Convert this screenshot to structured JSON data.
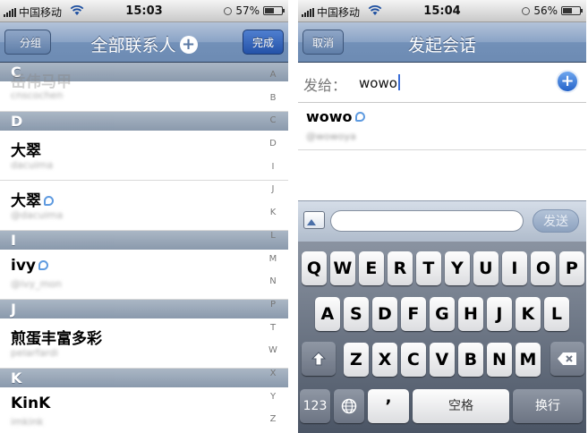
{
  "left": {
    "status": {
      "carrier": "中国移动",
      "time": "15:03",
      "battery_text": "57%",
      "battery_level": 0.57
    },
    "nav": {
      "back_label": "分组",
      "title": "全部联系人",
      "done_label": "完成"
    },
    "sections": [
      {
        "letter": "C",
        "rows": [
          {
            "name": "岳伟马甲",
            "sub": "cnscochen",
            "verified": false,
            "ghost": true
          }
        ]
      },
      {
        "letter": "D",
        "rows": [
          {
            "name": "大翠",
            "sub": "dacuima",
            "verified": false
          },
          {
            "name": "大翠",
            "sub": "@dacuima",
            "verified": true
          }
        ]
      },
      {
        "letter": "I",
        "rows": [
          {
            "name": "ivy",
            "sub": "@ivy_mon",
            "verified": true
          }
        ]
      },
      {
        "letter": "J",
        "rows": [
          {
            "name": "煎蛋丰富多彩",
            "sub": "pelarfardi",
            "verified": false
          }
        ]
      },
      {
        "letter": "K",
        "rows": [
          {
            "name": "KinK",
            "sub": "imkink",
            "verified": false
          }
        ]
      }
    ],
    "index_letters": [
      "A",
      "B",
      "C",
      "D",
      "I",
      "J",
      "K",
      "L",
      "M",
      "N",
      "P",
      "T",
      "W",
      "X",
      "Y",
      "Z"
    ]
  },
  "right": {
    "status": {
      "carrier": "中国移动",
      "time": "15:04",
      "battery_text": "56%",
      "battery_level": 0.56
    },
    "nav": {
      "cancel_label": "取消",
      "title": "发起会话"
    },
    "to_label": "发给：",
    "to_value": "wowo",
    "suggestion": {
      "name": "wowo",
      "sub": "@wowoya",
      "verified": true
    },
    "send_label": "发送",
    "keyboard": {
      "row1": [
        "Q",
        "W",
        "E",
        "R",
        "T",
        "Y",
        "U",
        "I",
        "O",
        "P"
      ],
      "row2": [
        "A",
        "S",
        "D",
        "F",
        "G",
        "H",
        "J",
        "K",
        "L"
      ],
      "row3": [
        "Z",
        "X",
        "C",
        "V",
        "B",
        "N",
        "M"
      ],
      "num_label": "123",
      "comma_label": "’",
      "space_label": "空格",
      "return_label": "换行"
    }
  }
}
